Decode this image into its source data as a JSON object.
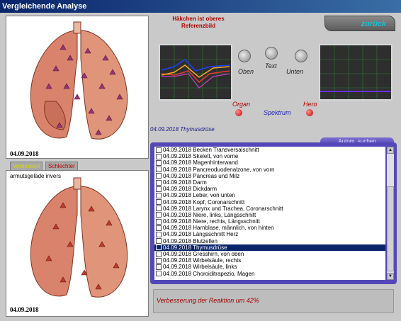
{
  "window": {
    "title": "Vergleichende Analyse"
  },
  "left": {
    "top_date": "04.09.2018",
    "improved_tag": "Verbessert",
    "worse_tag": "Schlechter",
    "bottom_caption": "armutsgeläde invers",
    "bottom_date": "04.09.2018"
  },
  "header": {
    "hint_line1": "Häkchen ist oberes",
    "hint_line2": "Referenzbild",
    "back_button": "zurück"
  },
  "controls": {
    "oben": "Oben",
    "text": "Text",
    "unten": "Unten",
    "organ": "Organ",
    "hero": "Hero",
    "spektrum": "Spektrum"
  },
  "selected_label": "04.09.2018 Thymusdrüse",
  "auto_search": "Autom. suchen",
  "list": [
    "04.09.2018  Becken Transversalschnitt",
    "04.09.2018  Skelett, von vorne",
    "04.09.2018  Magenhinterwand",
    "04.09.2018  Pancreoduodenalzone, von vorn",
    "04.09.2018  Pancreas und Milz",
    "04.09.2018  Darm",
    "04.09.2018  Dickdarm",
    "04.09.2018  Leber, von unten",
    "04.09.2018  Kopf, Coronarschnitt",
    "04.09.2018  Larynx und Trachea, Coronarschnitt",
    "04.09.2018  Niere, links, Längsschnitt",
    "04.09.2018  Niere, rechts, Längsschnitt",
    "04.09.2018  Harnblase, männlich, von hinten",
    "04.09.2018  Längsschnitt Herz",
    "04.09.2018  Blutzellen",
    "04.09.2018  Thymusdrüse",
    "04.09.2018  Gresshirn, von oben",
    "04.09.2018  Wirbelsäule, rechts",
    "04.09.2018  Wirbelsäule, links",
    "04.09.2018  Choroiditrapezio, Magen"
  ],
  "selected_index": 15,
  "result_text": "Verbesserung der Reaktion um 42%"
}
